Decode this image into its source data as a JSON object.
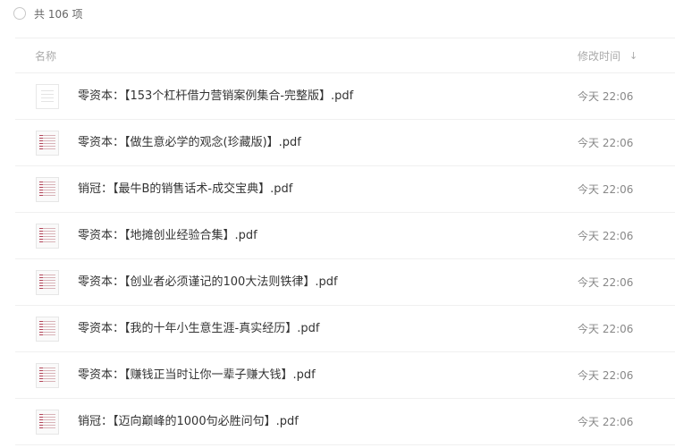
{
  "header": {
    "total_label": "共 106 项"
  },
  "columns": {
    "name": "名称",
    "time": "修改时间",
    "sort_icon": "arrow-down-icon"
  },
  "files": [
    {
      "name": "零资本：【153个杠杆借力营销案例集合-完整版】.pdf",
      "time": "今天 22:06",
      "thumb": "plain"
    },
    {
      "name": "零资本：【做生意必学的观念(珍藏版)】.pdf",
      "time": "今天 22:06",
      "thumb": "doc"
    },
    {
      "name": "销冠：【最牛B的销售话术-成交宝典】.pdf",
      "time": "今天 22:06",
      "thumb": "doc"
    },
    {
      "name": "零资本：【地摊创业经验合集】.pdf",
      "time": "今天 22:06",
      "thumb": "doc"
    },
    {
      "name": "零资本：【创业者必须谨记的100大法则铁律】.pdf",
      "time": "今天 22:06",
      "thumb": "doc"
    },
    {
      "name": "零资本：【我的十年小生意生涯-真实经历】.pdf",
      "time": "今天 22:06",
      "thumb": "doc"
    },
    {
      "name": "零资本：【赚钱正当时让你一辈子赚大钱】.pdf",
      "time": "今天 22:06",
      "thumb": "doc"
    },
    {
      "name": "销冠：【迈向巅峰的1000句必胜问句】.pdf",
      "time": "今天 22:06",
      "thumb": "doc"
    }
  ]
}
